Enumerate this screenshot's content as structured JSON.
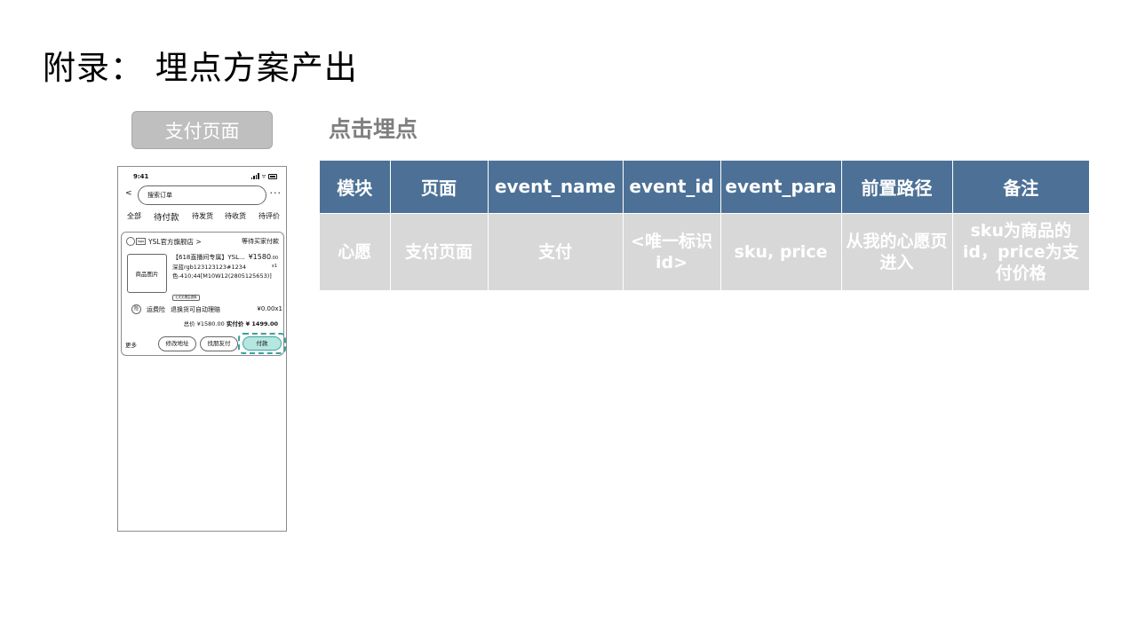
{
  "page_title": "附录： 埋点方案产出",
  "page_label": "支付页面",
  "section_title": "点击埋点",
  "phone": {
    "status_time": "9:41",
    "back": "<",
    "search_text": "搜索订单",
    "more": "···",
    "tabs": [
      "全部",
      "待付款",
      "待发货",
      "待收货",
      "待评价"
    ],
    "shop": {
      "logo": "logo",
      "name": "YSL官方旗舰店 >",
      "status": "等待买家付款"
    },
    "product": {
      "image_label": "商品图片",
      "title": "【618直播间专属】YSL...",
      "price": "¥1580",
      "price_cents": ".00",
      "qty": "x1",
      "spec": "深蓝rgb123123123#1234色-410;44[M10W12(2805125653)]",
      "tag": "七天无理由退换"
    },
    "insurance": {
      "icon": "险",
      "name": "运费险",
      "desc": "退换货可自动理赔",
      "price": "¥0.00x1"
    },
    "total": {
      "label": "总价 ¥1580.00",
      "paid_label": "实付价 ¥ 1499.00"
    },
    "actions": {
      "more": "更多",
      "modify_address": "修改地址",
      "find_friend_pay": "找朋友付",
      "pay": "付款"
    }
  },
  "table": {
    "headers": [
      "模块",
      "页面",
      "event_name",
      "event_id",
      "event_para",
      "前置路径",
      "备注"
    ],
    "rows": [
      [
        "心愿",
        "支付页面",
        "支付",
        "<唯一标识id>",
        "sku, price",
        "从我的心愿页进入",
        "sku为商品的id，price为支付价格"
      ]
    ]
  }
}
